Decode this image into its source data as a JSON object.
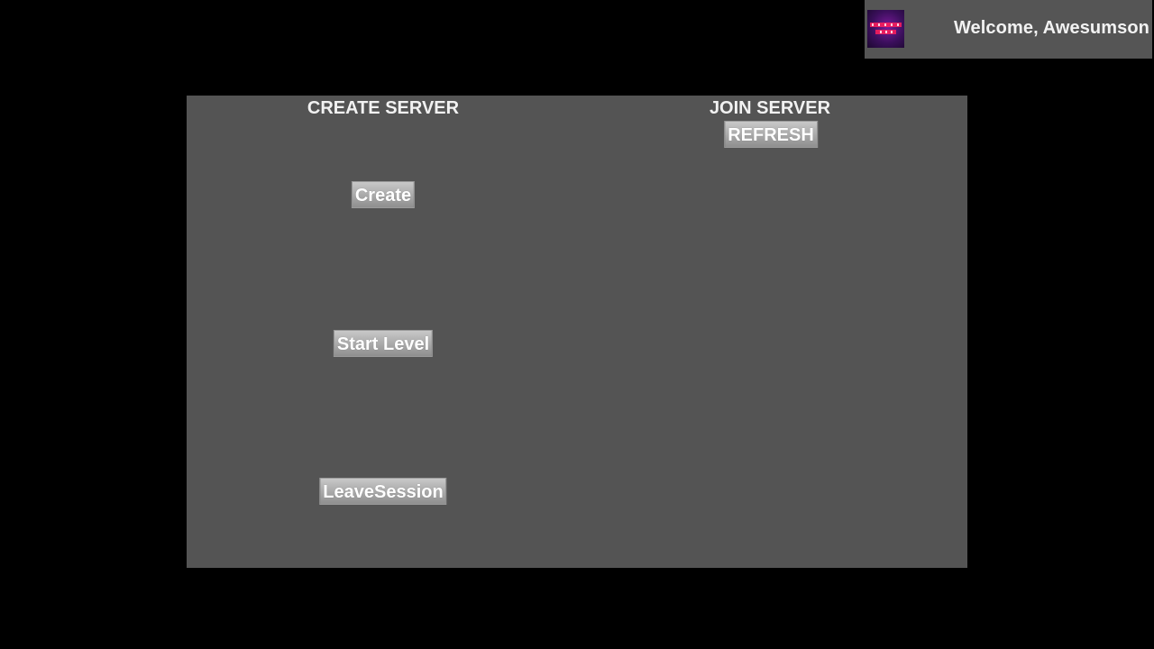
{
  "header": {
    "welcome_text": "Welcome, Awesumson",
    "avatar_icon": "game-logo-icon"
  },
  "create_server": {
    "title": "CREATE SERVER",
    "create_label": "Create",
    "start_level_label": "Start Level",
    "leave_session_label": "LeaveSession"
  },
  "join_server": {
    "title": "JOIN SERVER",
    "refresh_label": "REFRESH"
  },
  "colors": {
    "background": "#000000",
    "panel": "#545454",
    "badge": "#555555",
    "text": "#f2f2f2"
  }
}
